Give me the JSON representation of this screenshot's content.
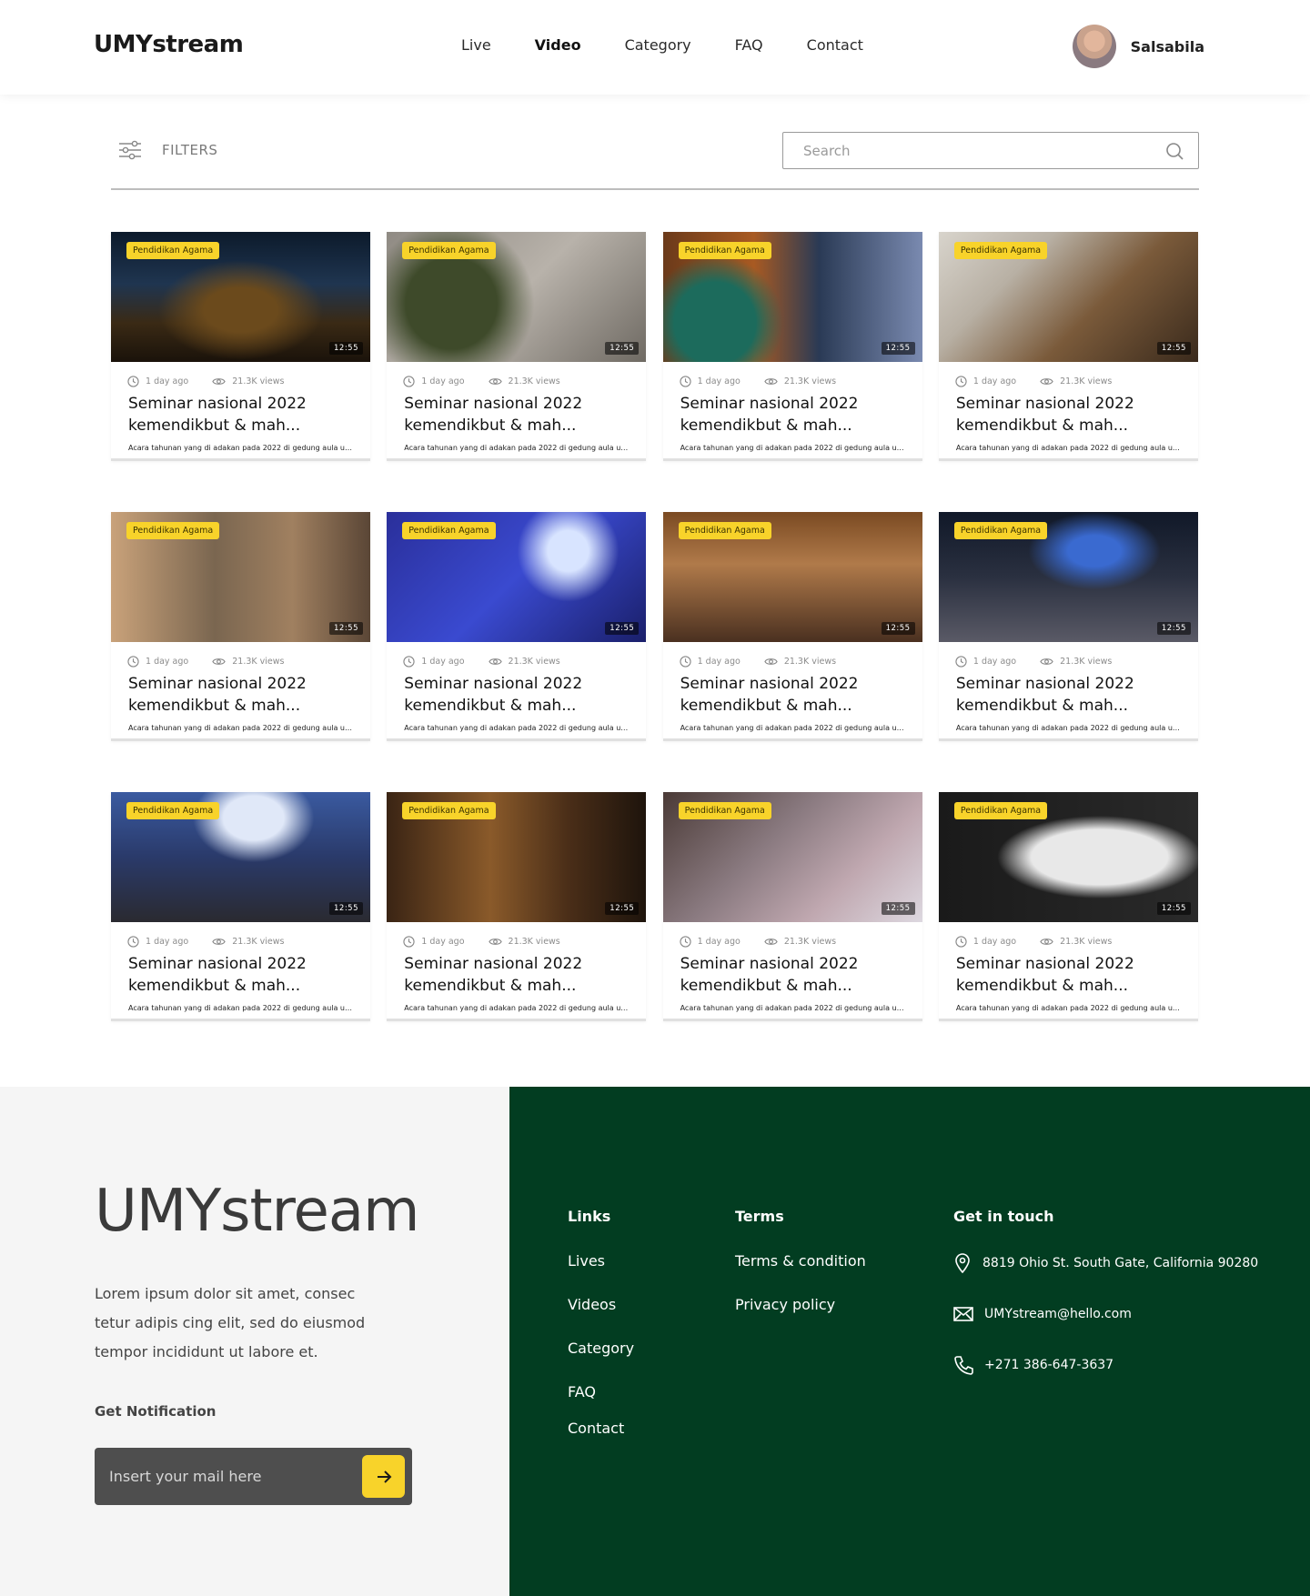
{
  "header": {
    "logo": "UMYstream",
    "nav": [
      "Live",
      "Video",
      "Category",
      "FAQ",
      "Contact"
    ],
    "active_nav": "Video",
    "user_name": "Salsabila"
  },
  "toolbar": {
    "filters_label": "FILTERS",
    "search_placeholder": "Search"
  },
  "videos": [
    {
      "badge": "Pendidikan Agama",
      "duration": "12:55",
      "time": "1 day ago",
      "views": "21.3K views",
      "title": "Seminar nasional 2022 kemendikbut & mah...",
      "desc": "Acara tahunan yang di adakan pada 2022 di gedung aula uni..."
    },
    {
      "badge": "Pendidikan Agama",
      "duration": "12:55",
      "time": "1 day ago",
      "views": "21.3K views",
      "title": "Seminar nasional 2022 kemendikbut & mah...",
      "desc": "Acara tahunan yang di adakan pada 2022 di gedung aula uni..."
    },
    {
      "badge": "Pendidikan Agama",
      "duration": "12:55",
      "time": "1 day ago",
      "views": "21.3K views",
      "title": "Seminar nasional 2022 kemendikbut & mah...",
      "desc": "Acara tahunan yang di adakan pada 2022 di gedung aula uni..."
    },
    {
      "badge": "Pendidikan Agama",
      "duration": "12:55",
      "time": "1 day ago",
      "views": "21.3K views",
      "title": "Seminar nasional 2022 kemendikbut & mah...",
      "desc": "Acara tahunan yang di adakan pada 2022 di gedung aula uni..."
    },
    {
      "badge": "Pendidikan Agama",
      "duration": "12:55",
      "time": "1 day ago",
      "views": "21.3K views",
      "title": "Seminar nasional 2022 kemendikbut & mah...",
      "desc": "Acara tahunan yang di adakan pada 2022 di gedung aula uni..."
    },
    {
      "badge": "Pendidikan Agama",
      "duration": "12:55",
      "time": "1 day ago",
      "views": "21.3K views",
      "title": "Seminar nasional 2022 kemendikbut & mah...",
      "desc": "Acara tahunan yang di adakan pada 2022 di gedung aula uni..."
    },
    {
      "badge": "Pendidikan Agama",
      "duration": "12:55",
      "time": "1 day ago",
      "views": "21.3K views",
      "title": "Seminar nasional 2022 kemendikbut & mah...",
      "desc": "Acara tahunan yang di adakan pada 2022 di gedung aula uni..."
    },
    {
      "badge": "Pendidikan Agama",
      "duration": "12:55",
      "time": "1 day ago",
      "views": "21.3K views",
      "title": "Seminar nasional 2022 kemendikbut & mah...",
      "desc": "Acara tahunan yang di adakan pada 2022 di gedung aula uni..."
    },
    {
      "badge": "Pendidikan Agama",
      "duration": "12:55",
      "time": "1 day ago",
      "views": "21.3K views",
      "title": "Seminar nasional 2022 kemendikbut & mah...",
      "desc": "Acara tahunan yang di adakan pada 2022 di gedung aula uni..."
    },
    {
      "badge": "Pendidikan Agama",
      "duration": "12:55",
      "time": "1 day ago",
      "views": "21.3K views",
      "title": "Seminar nasional 2022 kemendikbut & mah...",
      "desc": "Acara tahunan yang di adakan pada 2022 di gedung aula uni..."
    },
    {
      "badge": "Pendidikan Agama",
      "duration": "12:55",
      "time": "1 day ago",
      "views": "21.3K views",
      "title": "Seminar nasional 2022 kemendikbut & mah...",
      "desc": "Acara tahunan yang di adakan pada 2022 di gedung aula uni..."
    },
    {
      "badge": "Pendidikan Agama",
      "duration": "12:55",
      "time": "1 day ago",
      "views": "21.3K views",
      "title": "Seminar nasional 2022 kemendikbut & mah...",
      "desc": "Acara tahunan yang di adakan pada 2022 di gedung aula uni..."
    }
  ],
  "footer": {
    "logo": "UMYstream",
    "description": "Lorem ipsum dolor sit amet, consec tetur adipis cing elit, sed do eiusmod tempor incididunt ut labore et.",
    "notification_label": "Get Notification",
    "mail_placeholder": "Insert your mail here",
    "links_heading": "Links",
    "links": [
      "Lives",
      "Videos",
      "Category",
      "FAQ",
      "Contact"
    ],
    "terms_heading": "Terms",
    "terms": [
      "Terms & condition",
      "Privacy policy"
    ],
    "contact_heading": "Get in touch",
    "address": "8819 Ohio St. South Gate, California 90280",
    "email": "UMYstream@hello.com",
    "phone": "+271 386-647-3637"
  },
  "colors": {
    "accent_yellow": "#f8d32a",
    "footer_green": "#023d21",
    "footer_left_bg": "#f5f5f5"
  }
}
